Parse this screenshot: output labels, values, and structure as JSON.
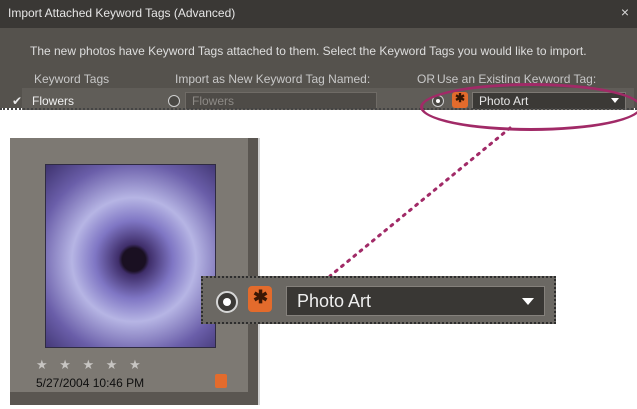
{
  "dialog": {
    "title": "Import Attached Keyword Tags (Advanced)",
    "close_glyph": "×",
    "description": "The new photos have Keyword Tags attached to them.  Select the Keyword Tags you would like to import.",
    "columns": {
      "keyword_tags": "Keyword Tags",
      "import_as": "Import as New Keyword Tag Named:",
      "or": "OR",
      "use_existing": "Use an Existing Keyword Tag:"
    },
    "row": {
      "checkbox": "✔",
      "label": "Flowers",
      "new_name_placeholder": "Flowers",
      "existing_value": "Photo Art"
    }
  },
  "photo": {
    "stars": "★ ★ ★ ★ ★",
    "date": "5/27/2004 10:46 PM"
  },
  "zoom": {
    "value": "Photo Art"
  },
  "colors": {
    "accent": "#a12a67",
    "tag_orange": "#e36b2c"
  }
}
